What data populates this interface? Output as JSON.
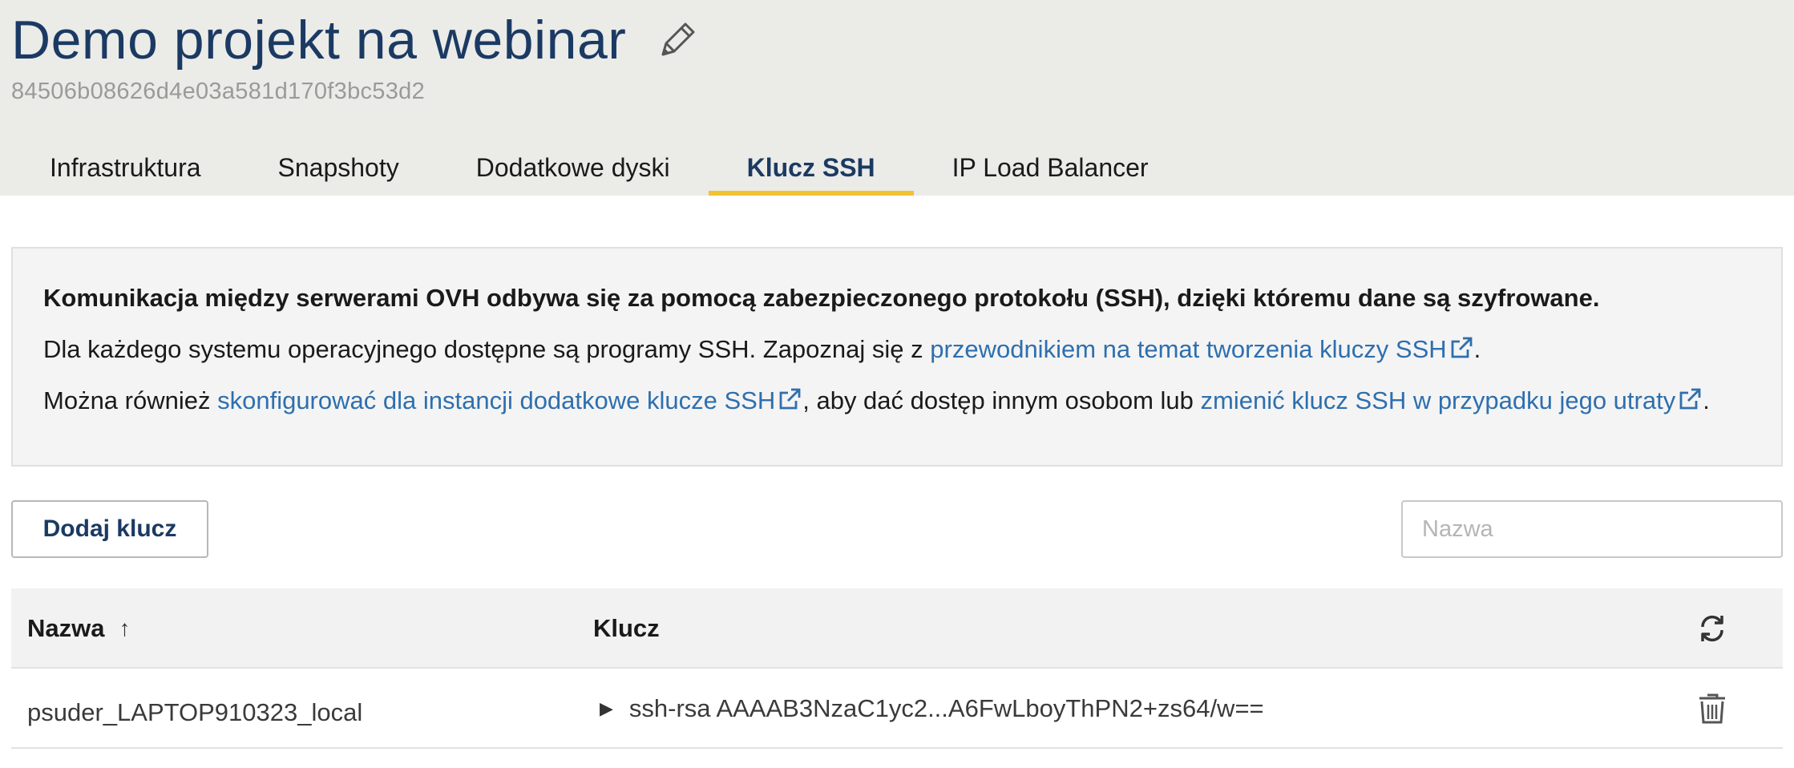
{
  "header": {
    "title": "Demo projekt na webinar",
    "project_id": "84506b08626d4e03a581d170f3bc53d2",
    "edit_icon": "pencil-icon"
  },
  "tabs": [
    {
      "label": "Infrastruktura",
      "active": false
    },
    {
      "label": "Snapshoty",
      "active": false
    },
    {
      "label": "Dodatkowe dyski",
      "active": false
    },
    {
      "label": "Klucz SSH",
      "active": true
    },
    {
      "label": "IP Load Balancer",
      "active": false
    }
  ],
  "info": {
    "line1": "Komunikacja między serwerami OVH odbywa się za pomocą zabezpieczonego protokołu (SSH), dzięki któremu dane są szyfrowane.",
    "line2_prefix": "Dla każdego systemu operacyjnego dostępne są programy SSH. Zapoznaj się z ",
    "line2_link": "przewodnikiem na temat tworzenia kluczy SSH",
    "line2_suffix": ".",
    "line3_prefix": "Można również ",
    "line3_link1": "skonfigurować dla instancji dodatkowe klucze SSH",
    "line3_middle": ", aby dać dostęp innym osobom lub ",
    "line3_link2": "zmienić klucz SSH w przypadku jego utraty",
    "line3_suffix": "."
  },
  "actions": {
    "add_key_label": "Dodaj klucz",
    "search_placeholder": "Nazwa"
  },
  "table": {
    "columns": {
      "name": "Nazwa",
      "key": "Klucz"
    },
    "sort_indicator": "↑",
    "rows": [
      {
        "name": "psuder_LAPTOP910323_local",
        "key": "ssh-rsa AAAAB3NzaC1yc2...A6FwLboyThPN2+zs64/w=="
      }
    ]
  },
  "colors": {
    "title": "#1b3a63",
    "link": "#2e6fae",
    "active_tab_underline": "#f2c230",
    "header_bg": "#ebebe8"
  }
}
